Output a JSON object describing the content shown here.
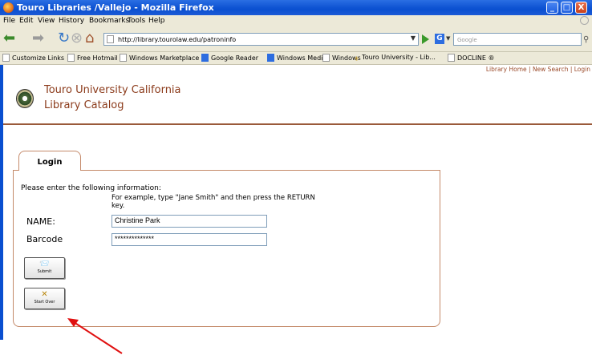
{
  "window": {
    "title": "Touro Libraries /Vallejo - Mozilla Firefox",
    "controls": [
      "_",
      "□",
      "X"
    ]
  },
  "menu": [
    "File",
    "Edit",
    "View",
    "History",
    "Bookmarks",
    "Tools",
    "Help"
  ],
  "nav": {
    "url": "http://library.tourolaw.edu/patroninfo",
    "search_engine_letter": "G",
    "search_placeholder": "Google"
  },
  "bookmarks": [
    {
      "label": "Customize Links",
      "icon": "page-icon"
    },
    {
      "label": "Free Hotmail",
      "icon": "page-icon"
    },
    {
      "label": "Windows Marketplace",
      "icon": "page-icon"
    },
    {
      "label": "Google Reader",
      "icon": "google-reader-icon"
    },
    {
      "label": "Windows Media",
      "icon": "windows-media-icon"
    },
    {
      "label": "Windows",
      "icon": "page-icon"
    },
    {
      "label": "Touro University - Lib...",
      "icon": "touro-icon"
    },
    {
      "label": "DOCLINE ®",
      "icon": "page-icon"
    }
  ],
  "page": {
    "top_links": {
      "home": "Library Home",
      "sep1": "|",
      "search": "New Search",
      "sep2": "|",
      "login": "Login"
    },
    "brand": {
      "line1": "Touro University California",
      "line2": "Library Catalog"
    },
    "tab_label": "Login",
    "instructions": "Please enter the following information:",
    "example": "For example, type \"Jane Smith\" and then press the RETURN key.",
    "name_label": "NAME:",
    "name_value": "Christine Park",
    "barcode_label": "Barcode",
    "barcode_value": "**************",
    "submit_label": "Submit",
    "startover_label": "Start Over"
  }
}
